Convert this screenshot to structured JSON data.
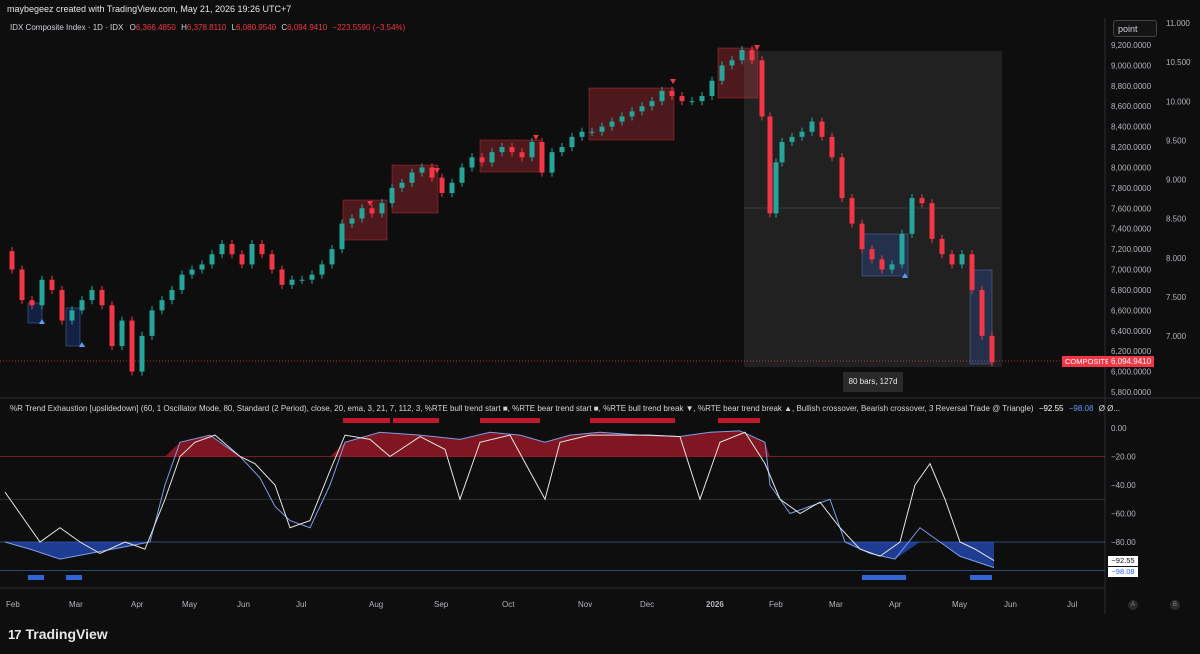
{
  "header": {
    "credit": "maybegeez created with TradingView.com, May 21, 2026 19:26 UTC+7"
  },
  "symbol": {
    "name": "IDX Composite Index · 1D · IDX",
    "open_label": "O",
    "open": "6,366.4850",
    "high_label": "H",
    "high": "6,378.8110",
    "low_label": "L",
    "low": "6,080.9540",
    "close_label": "C",
    "close": "6,094.9410",
    "change": "−223.5590 (−3.54%)"
  },
  "toolbar": {
    "point_label": "point"
  },
  "price_axis": [
    "9,200.0000",
    "9,000.0000",
    "8,800.0000",
    "8,600.0000",
    "8,400.0000",
    "8,200.0000",
    "8,000.0000",
    "7,800.0000",
    "7,600.0000",
    "7,400.0000",
    "7,200.0000",
    "7,000.0000",
    "6,800.0000",
    "6,600.0000",
    "6,400.0000",
    "6,200.0000",
    "6,000.0000",
    "5,800.0000"
  ],
  "secondary_axis": [
    "11.000",
    "10.500",
    "10.000",
    "9.500",
    "9.000",
    "8.500",
    "8.000",
    "7.500",
    "7.000"
  ],
  "current_price": {
    "symbol_tag": "COMPOSITE",
    "value": "6,094.9410"
  },
  "measure": {
    "label": "80 bars, 127d"
  },
  "indicator": {
    "title": "%R Trend Exhaustion [upslidedown] (60, 1 Oscillator Mode, 80, Standard (2 Period), close, 20, ema, 3, 21, 7, 112, 3, %RTE bull trend start ■, %RTE bear trend start ■, %RTE bull trend break ▼, %RTE bear trend break ▲, Bullish crossover, Bearish crossover, 3 Reversal Trade @ Triangle)",
    "value1": "−92.55",
    "value2": "−98.08",
    "extra": "Ø  Ø...",
    "axis": [
      "0.00",
      "−20.00",
      "−40.00",
      "−60.00",
      "−80.00"
    ],
    "tag_white": "−92.55",
    "tag_blue": "−98.08"
  },
  "time_axis": [
    "Feb",
    "Mar",
    "Apr",
    "May",
    "Jun",
    "Jul",
    "Aug",
    "Sep",
    "Oct",
    "Nov",
    "Dec",
    "2026",
    "Feb",
    "Mar",
    "Apr",
    "May",
    "Jun",
    "Jul"
  ],
  "footer": {
    "logo_mark": "17",
    "logo_text": "TradingView",
    "btn_a": "A",
    "btn_b": "B"
  },
  "colors": {
    "bull": "#26a69a",
    "bear": "#f23645",
    "accent_blue": "#2962ff",
    "background": "#0e0e0e"
  }
}
